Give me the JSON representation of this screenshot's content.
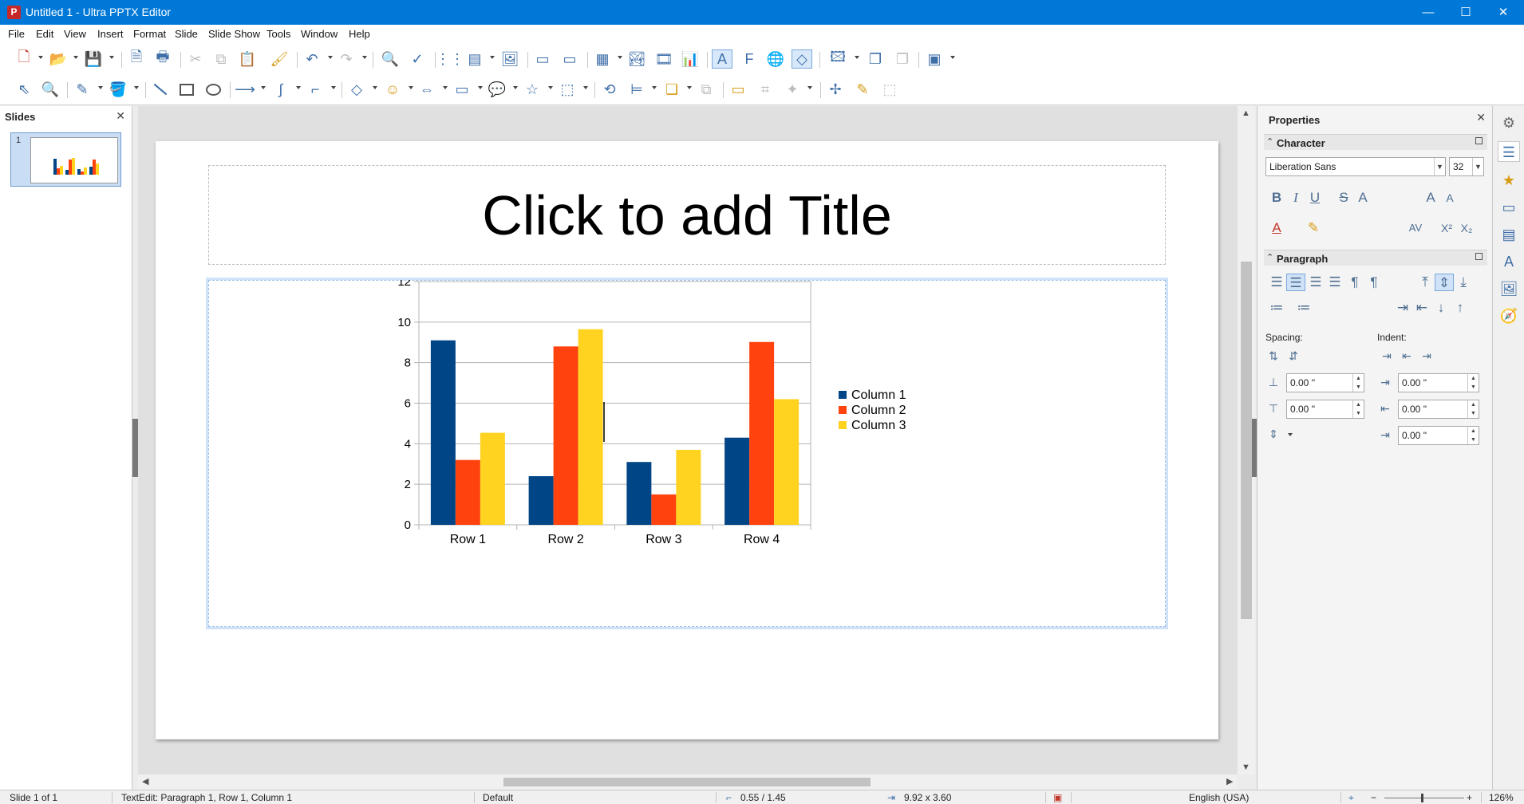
{
  "window": {
    "title": "Untitled 1 - Ultra PPTX Editor",
    "app_icon": "P",
    "minimize": "—",
    "maximize": "☐",
    "close": "✕"
  },
  "menu": [
    "File",
    "Edit",
    "View",
    "Insert",
    "Format",
    "Slide",
    "Slide Show",
    "Tools",
    "Window",
    "Help"
  ],
  "slides_pane": {
    "title": "Slides",
    "close": "✕",
    "slide_number": "1"
  },
  "slide": {
    "title_placeholder": "Click to add Title"
  },
  "chart_data": {
    "type": "bar",
    "categories": [
      "Row 1",
      "Row 2",
      "Row 3",
      "Row 4"
    ],
    "series": [
      {
        "name": "Column 1",
        "values": [
          9.1,
          2.4,
          3.1,
          4.3
        ],
        "color": "#004586"
      },
      {
        "name": "Column 2",
        "values": [
          3.2,
          8.8,
          1.5,
          9.02
        ],
        "color": "#ff420e"
      },
      {
        "name": "Column 3",
        "values": [
          4.54,
          9.65,
          3.7,
          6.2
        ],
        "color": "#ffd320"
      }
    ],
    "ylim": [
      0,
      12
    ],
    "yticks": [
      0,
      2,
      4,
      6,
      8,
      10,
      12
    ],
    "grid": true,
    "legend": "right",
    "title": "",
    "xlabel": "",
    "ylabel": ""
  },
  "properties": {
    "title": "Properties",
    "close": "✕",
    "character_label": "Character",
    "font_name": "Liberation Sans",
    "font_size": "32",
    "paragraph_label": "Paragraph",
    "spacing_label": "Spacing:",
    "indent_label": "Indent:",
    "spacing_above": "0.00 \"",
    "spacing_below": "0.00 \"",
    "indent_before": "0.00 \"",
    "indent_after": "0.00 \"",
    "indent_first": "0.00 \""
  },
  "status": {
    "slide": "Slide 1 of 1",
    "edit": "TextEdit: Paragraph 1, Row 1, Column 1",
    "master": "Default",
    "position": "0.55 / 1.45",
    "size": "9.92 x 3.60",
    "language": "English (USA)",
    "zoom": "126%"
  }
}
